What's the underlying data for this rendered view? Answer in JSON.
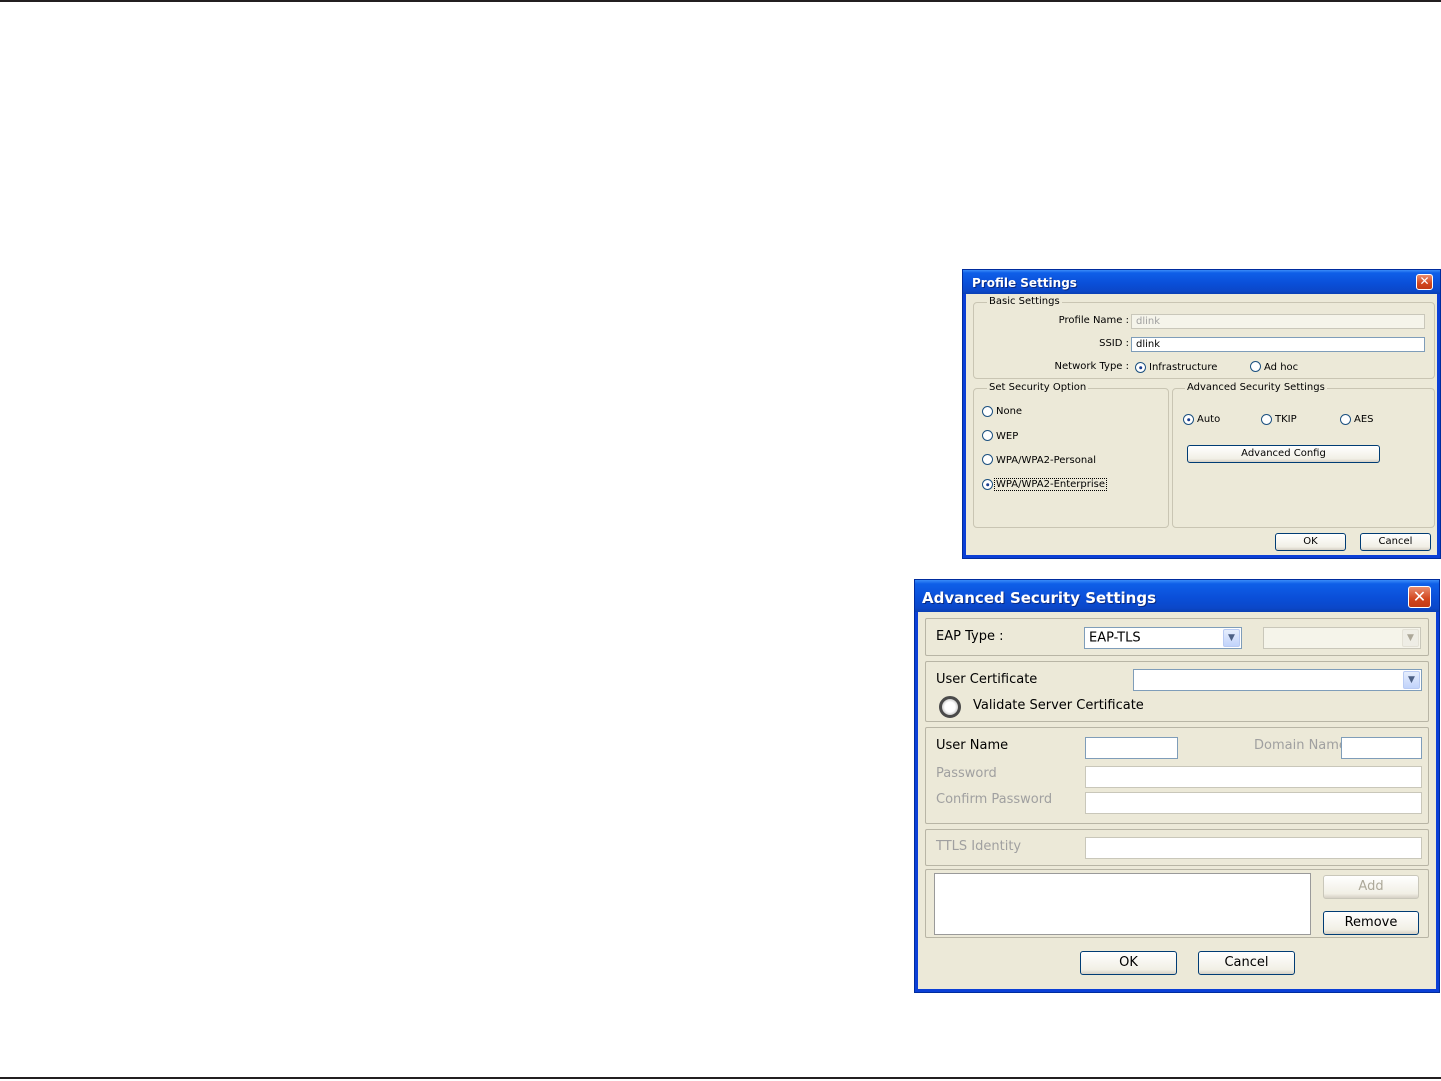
{
  "profile_settings": {
    "title": "Profile Settings",
    "close_glyph": "✕",
    "basic": {
      "legend": "Basic Settings",
      "profile_name_label": "Profile Name :",
      "profile_name_value": "dlink",
      "ssid_label": "SSID :",
      "ssid_value": "dlink",
      "network_type_label": "Network Type :",
      "options": [
        {
          "label": "Infrastructure",
          "checked": true
        },
        {
          "label": "Ad hoc",
          "checked": false
        }
      ]
    },
    "security": {
      "legend": "Set Security Option",
      "options": [
        {
          "label": "None",
          "checked": false
        },
        {
          "label": "WEP",
          "checked": false
        },
        {
          "label": "WPA/WPA2-Personal",
          "checked": false
        },
        {
          "label": "WPA/WPA2-Enterprise",
          "checked": true
        }
      ]
    },
    "advanced": {
      "legend": "Advanced Security Settings",
      "options": [
        {
          "label": "Auto",
          "checked": true
        },
        {
          "label": "TKIP",
          "checked": false
        },
        {
          "label": "AES",
          "checked": false
        }
      ],
      "config_button": "Advanced Config"
    },
    "ok_button": "OK",
    "cancel_button": "Cancel"
  },
  "advanced_security_settings": {
    "title": "Advanced Security Settings",
    "close_glyph": "✕",
    "eap_type_label": "EAP Type :",
    "eap_type_value": "EAP-TLS",
    "eap_secondary_value": "",
    "user_certificate_label": "User Certificate",
    "user_certificate_value": "",
    "validate_server_label": "Validate Server Certificate",
    "user_name_label": "User Name",
    "user_name_value": "",
    "domain_name_label": "Domain Name",
    "domain_name_value": "",
    "password_label": "Password",
    "confirm_password_label": "Confirm Password",
    "ttls_identity_label": "TTLS Identity",
    "add_button": "Add",
    "remove_button": "Remove",
    "ok_button": "OK",
    "cancel_button": "Cancel"
  }
}
